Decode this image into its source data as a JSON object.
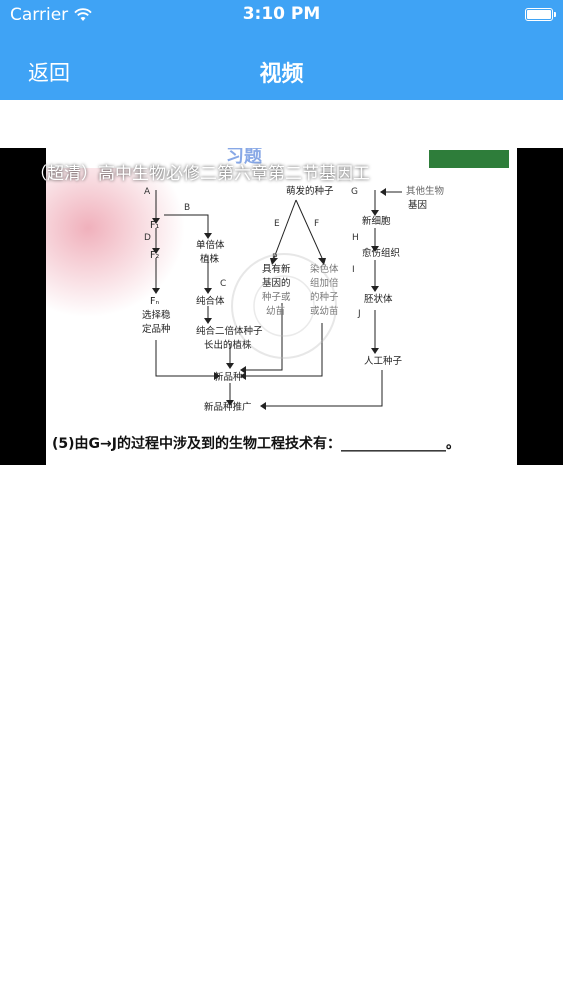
{
  "status_bar": {
    "carrier": "Carrier",
    "time": "3:10 PM",
    "wifi_icon": "wifi-icon",
    "battery_icon": "battery-icon"
  },
  "nav": {
    "back_label": "返回",
    "title": "视频"
  },
  "video": {
    "title": "（超清）高中生物必修二第六章第二节基因工",
    "slide": {
      "header_logo": "习题",
      "labels": {
        "A": "A",
        "B": "B",
        "C": "C",
        "D": "D",
        "E": "E",
        "F": "F",
        "G": "G",
        "H": "H",
        "I": "I",
        "J": "J",
        "P": "P"
      },
      "nodes": {
        "seed_source": "萌发的种子",
        "f1": "F₁",
        "f2": "F₂",
        "fn": "Fₙ",
        "select_stable_1": "选择稳",
        "select_stable_2": "定品种",
        "haploid_1": "单倍体",
        "haploid_2": "植株",
        "pure_1": "纯合体",
        "pure_seed_1": "纯合二倍体种子",
        "pure_seed_2": "长出的植株",
        "new_gene_1": "具有新",
        "new_gene_2": "基因的",
        "new_gene_3": "种子或",
        "new_gene_4": "幼苗",
        "chromo_1": "染色体",
        "chromo_2": "组加倍",
        "chromo_3": "的种子",
        "chromo_4": "或幼苗",
        "other_gene_1": "其他生物",
        "other_gene_2": "基因",
        "new_cell": "新细胞",
        "callus": "愈伤组织",
        "embryoid": "胚状体",
        "artificial_seed": "人工种子",
        "new_variety": "新品种",
        "promote": "新品种推广"
      },
      "question": "(5)由G→J的过程中涉及到的生物工程技术有：_______________。"
    }
  }
}
